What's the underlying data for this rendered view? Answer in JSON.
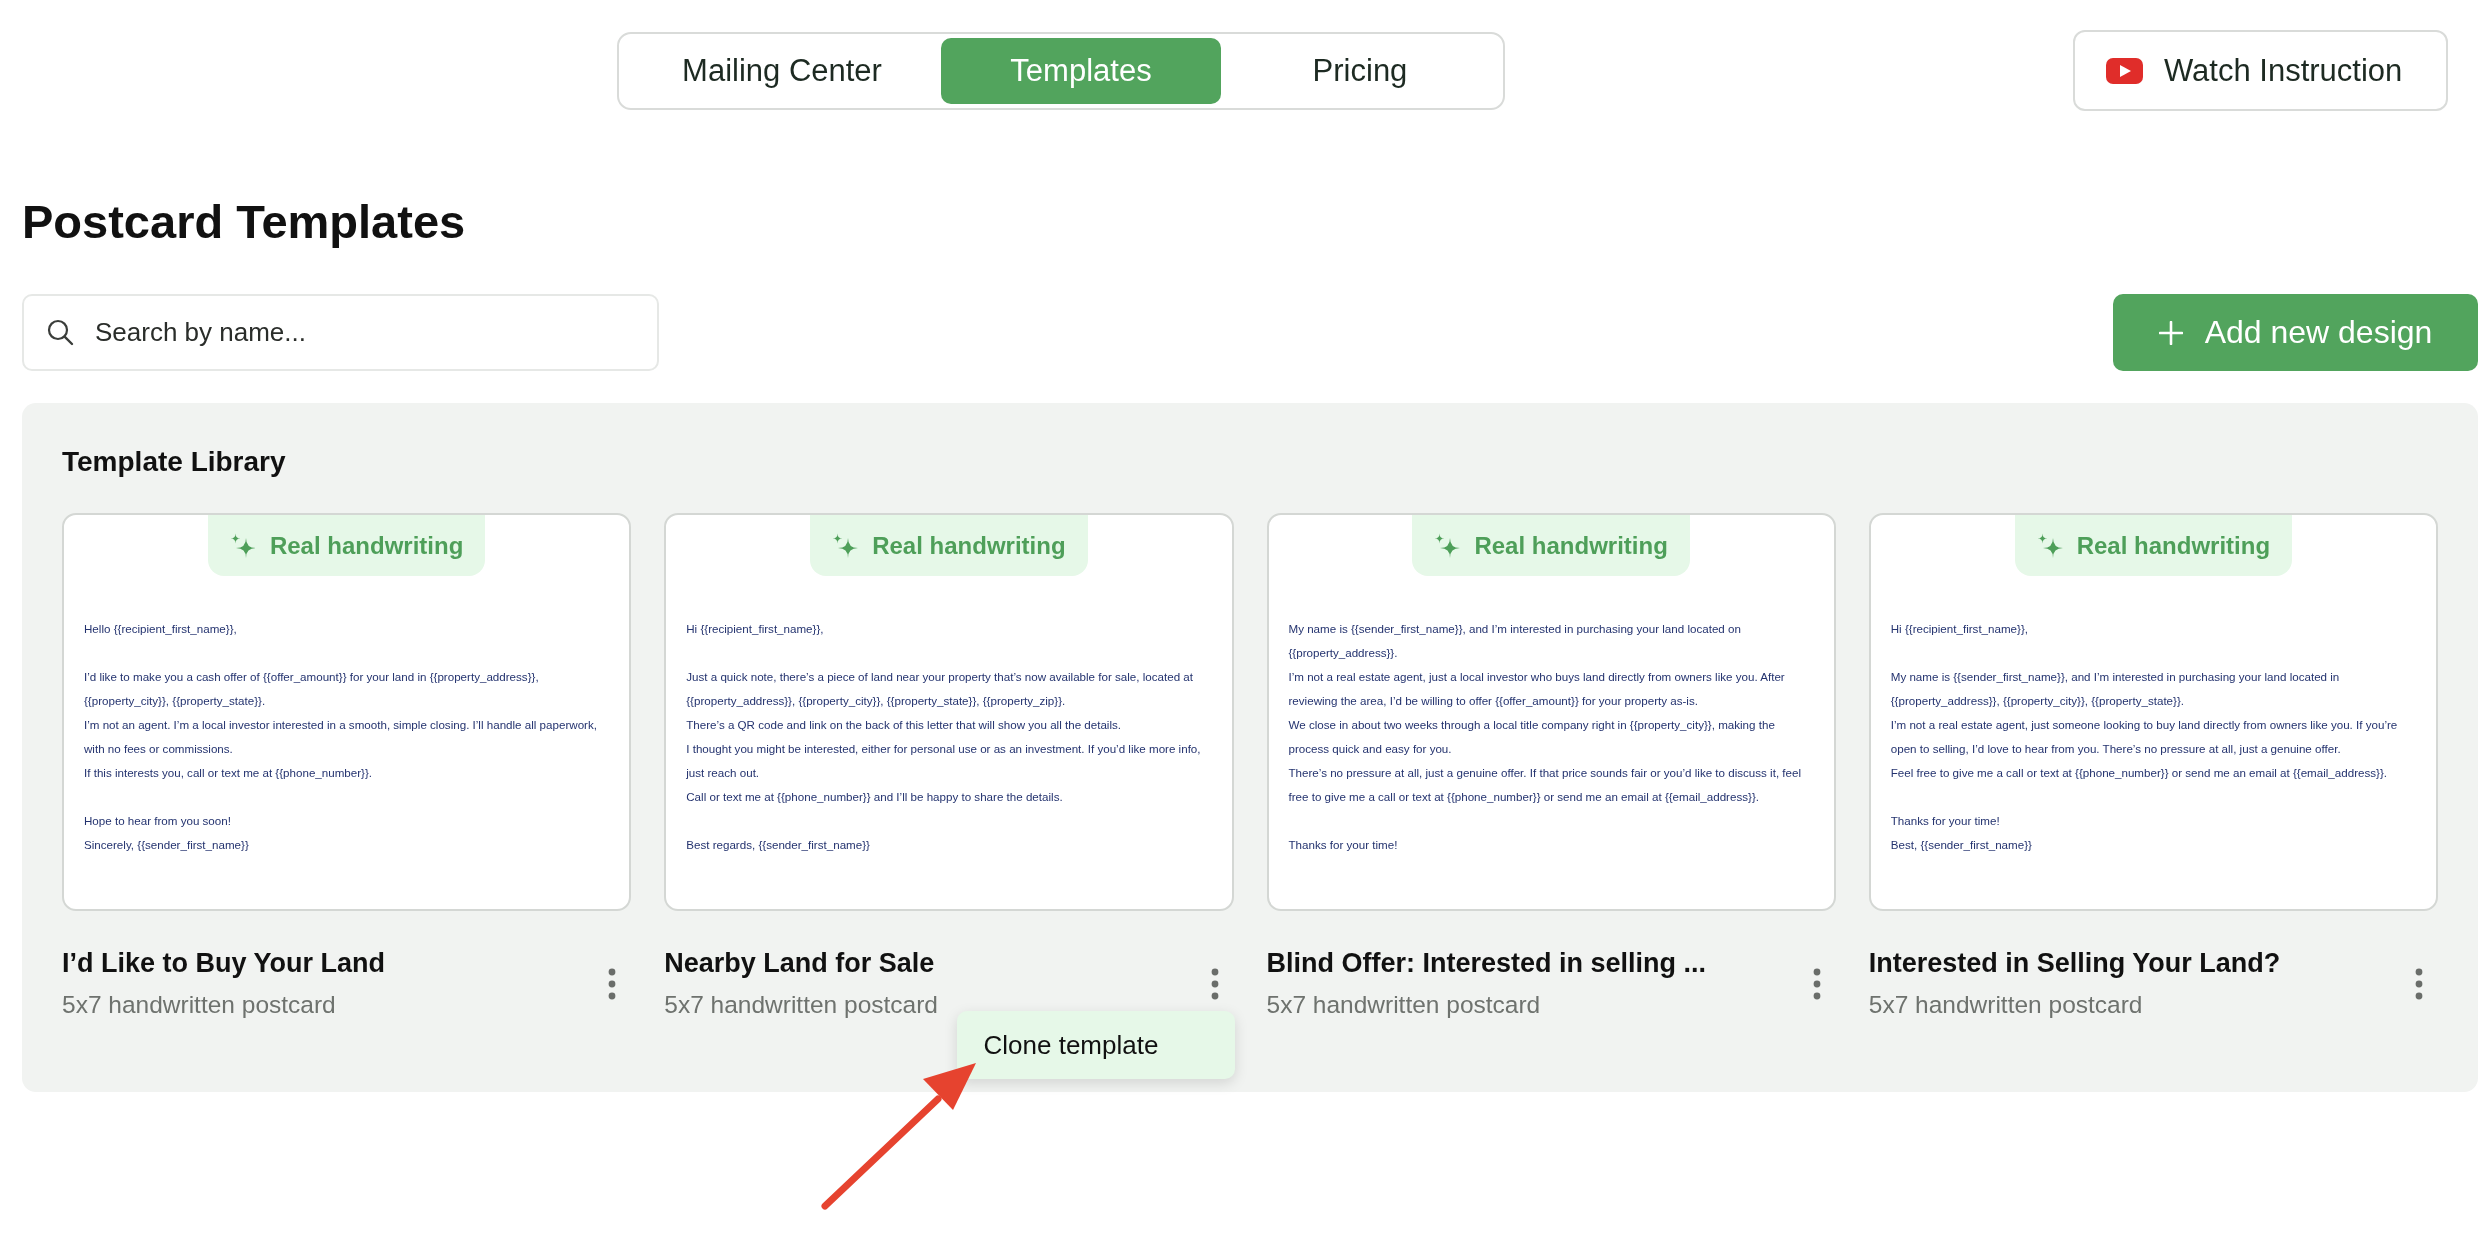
{
  "nav": {
    "tabs": [
      {
        "label": "Mailing Center",
        "selected": false
      },
      {
        "label": "Templates",
        "selected": true
      },
      {
        "label": "Pricing",
        "selected": false
      }
    ],
    "watch_button": {
      "label": "Watch Instruction"
    }
  },
  "page_title": "Postcard Templates",
  "search": {
    "placeholder": "Search by name..."
  },
  "add_button": {
    "label": "Add new design"
  },
  "library": {
    "title": "Template Library",
    "templates": [
      {
        "badge": "Real handwriting",
        "letter": "Hello {{recipient_first_name}},\n\nI’d like to make you a cash offer of {{offer_amount}} for your land in {{property_address}}, {{property_city}}, {{property_state}}.\nI’m not an agent. I’m a local investor interested in a smooth, simple closing. I’ll handle all paperwork, with no fees or commissions.\nIf this interests you, call or text me at {{phone_number}}.\n\nHope to hear from you soon!\nSincerely, {{sender_first_name}}",
        "name": "I’d Like to Buy Your Land",
        "subtitle": "5x7 handwritten postcard"
      },
      {
        "badge": "Real handwriting",
        "letter": "Hi {{recipient_first_name}},\n\nJust a quick note, there’s a piece of land near your property that’s now available for sale, located at {{property_address}}, {{property_city}}, {{property_state}}, {{property_zip}}.\nThere’s a QR code and link on the back of this letter that will show you all the details.\nI thought you might be interested, either for personal use or as an investment. If you’d like more info, just reach out.\nCall or text me at {{phone_number}} and I’ll be happy to share the details.\n\nBest regards, {{sender_first_name}}",
        "name": "Nearby Land for Sale",
        "subtitle": "5x7 handwritten postcard",
        "menu": {
          "items": [
            "Clone template"
          ]
        }
      },
      {
        "badge": "Real handwriting",
        "letter": "My name is {{sender_first_name}}, and I’m interested in purchasing your land located on {{property_address}}.\nI’m not a real estate agent, just a local investor who buys land directly from owners like you. After reviewing the area, I’d be willing to offer {{offer_amount}} for your property as-is.\nWe close in about two weeks through a local title company right in {{property_city}}, making the process quick and easy for you.\nThere’s no pressure at all, just a genuine offer. If that price sounds fair or you’d like to discuss it, feel free to give me a call or text at {{phone_number}} or send me an email at {{email_address}}.\n\nThanks for your time!",
        "name": "Blind Offer: Interested in selling ...",
        "subtitle": "5x7 handwritten postcard"
      },
      {
        "badge": "Real handwriting",
        "letter": "Hi {{recipient_first_name}},\n\nMy name is {{sender_first_name}}, and I’m interested in purchasing your land located in {{property_address}}, {{property_city}}, {{property_state}}.\nI’m not a real estate agent, just someone looking to buy land directly from owners like you. If you’re open to selling, I’d love to hear from you. There’s no pressure at all, just a genuine offer.\nFeel free to give me a call or text at {{phone_number}} or send me an email at {{email_address}}.\n\nThanks for your time!\nBest, {{sender_first_name}}",
        "name": "Interested in Selling Your Land?",
        "subtitle": "5x7 handwritten postcard"
      }
    ]
  }
}
